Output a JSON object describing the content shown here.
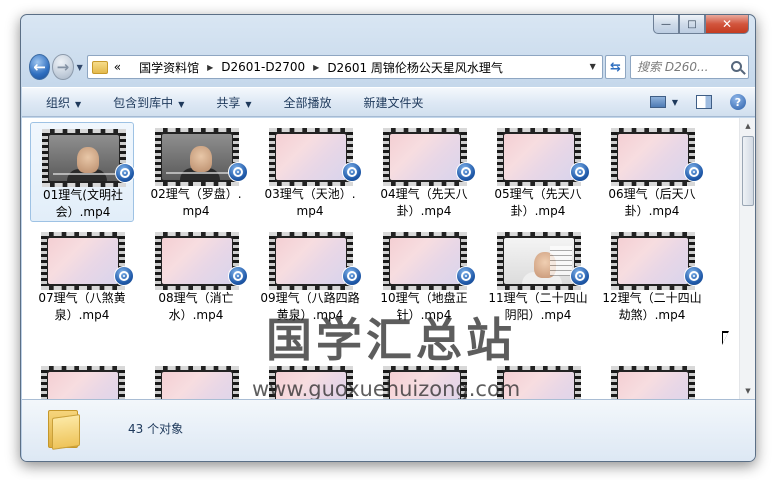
{
  "window": {
    "minimize_glyph": "—",
    "maximize_glyph": "□",
    "close_glyph": "✕"
  },
  "nav": {
    "back_glyph": "←",
    "forward_glyph": "→",
    "refresh_glyph": "⇆"
  },
  "address": {
    "overflow": "«",
    "crumbs": [
      "国学资料馆",
      "D2601-D2700",
      "D2601 周锦伦杨公天星风水理气"
    ]
  },
  "search": {
    "placeholder": "搜索 D260..."
  },
  "commands": {
    "organize": "组织",
    "include_library": "包含到库中",
    "share": "共享",
    "play_all": "全部播放",
    "new_folder": "新建文件夹"
  },
  "files": [
    {
      "name": "01理气(文明社会）.mp4",
      "thumb": "video",
      "selected": true
    },
    {
      "name": "02理气（罗盘）.mp4",
      "thumb": "video"
    },
    {
      "name": "03理气（天池）.mp4",
      "thumb": "gradient"
    },
    {
      "name": "04理气（先天八卦）.mp4",
      "thumb": "gradient"
    },
    {
      "name": "05理气（先天八卦）.mp4",
      "thumb": "gradient"
    },
    {
      "name": "06理气（后天八卦）.mp4",
      "thumb": "gradient"
    },
    {
      "name": "07理气（八煞黄泉）.mp4",
      "thumb": "gradient"
    },
    {
      "name": "08理气（消亡水）.mp4",
      "thumb": "gradient"
    },
    {
      "name": "09理气（八路四路黄泉）.mp4",
      "thumb": "gradient"
    },
    {
      "name": "10理气（地盘正针）.mp4",
      "thumb": "gradient"
    },
    {
      "name": "11理气（二十四山阴阳）.mp4",
      "thumb": "board"
    },
    {
      "name": "12理气（二十四山劫煞）.mp4",
      "thumb": "gradient"
    },
    {
      "name": "",
      "thumb": "gradient"
    },
    {
      "name": "",
      "thumb": "gradient"
    },
    {
      "name": "",
      "thumb": "gradient"
    },
    {
      "name": "",
      "thumb": "gradient"
    },
    {
      "name": "",
      "thumb": "gradient"
    },
    {
      "name": "",
      "thumb": "gradient"
    }
  ],
  "watermark": {
    "text": "国学汇总站",
    "url": "www.guoxuehuizong.com"
  },
  "status": {
    "count": "43 个对象"
  }
}
